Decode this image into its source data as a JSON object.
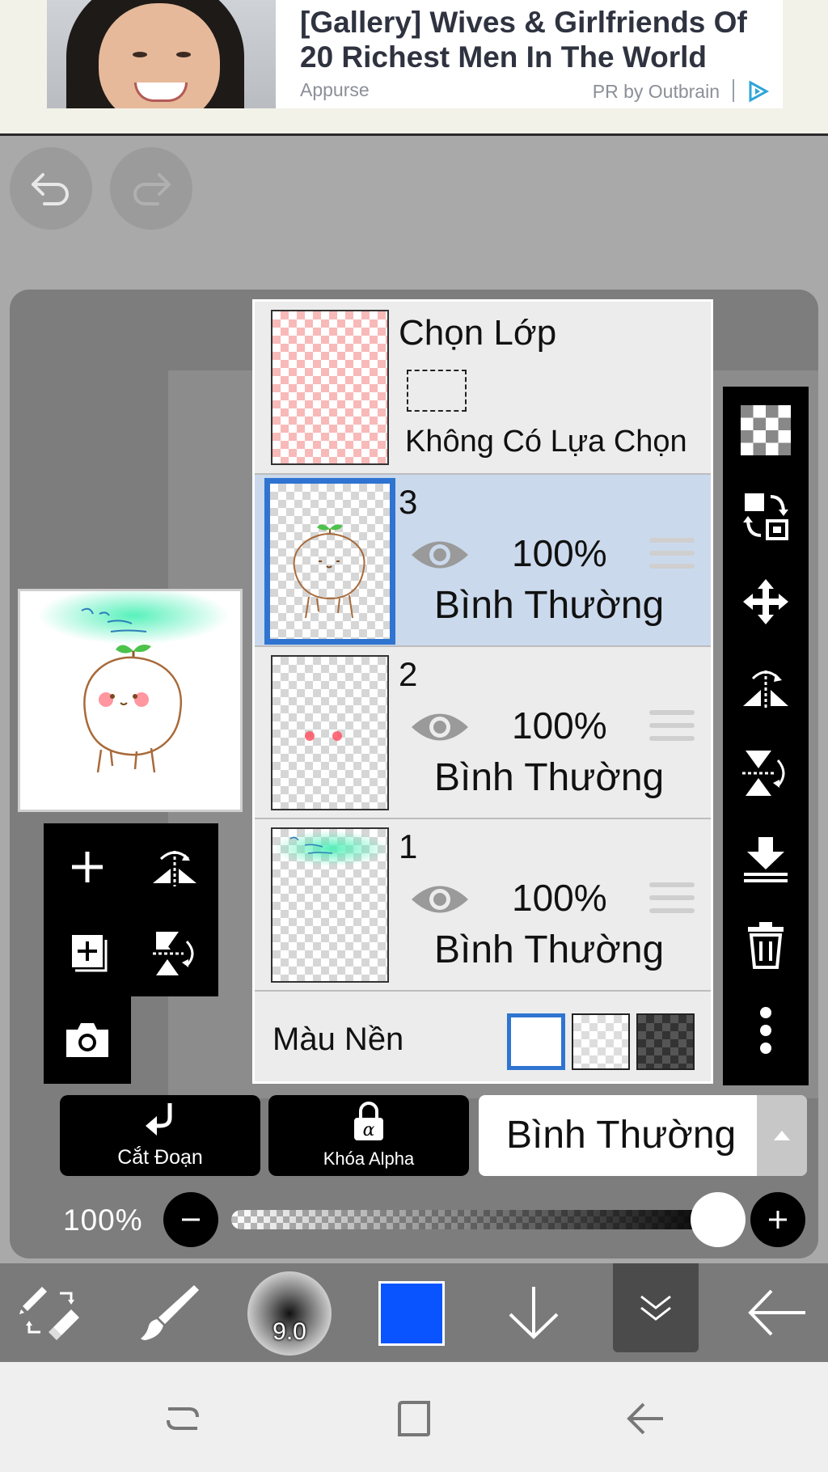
{
  "ad": {
    "title": "[Gallery] Wives & Girlfriends Of 20 Richest Men In The World",
    "source": "Appurse",
    "sponsor": "PR by Outbrain"
  },
  "layers_panel": {
    "selection": {
      "title": "Chọn Lớp",
      "status": "Không Có Lựa Chọn"
    },
    "layers": [
      {
        "number": "3",
        "opacity": "100%",
        "blend": "Bình Thường",
        "selected": true
      },
      {
        "number": "2",
        "opacity": "100%",
        "blend": "Bình Thường",
        "selected": false
      },
      {
        "number": "1",
        "opacity": "100%",
        "blend": "Bình Thường",
        "selected": false
      }
    ],
    "background": {
      "label": "Màu Nền",
      "options": [
        "white",
        "transparent",
        "dark-checker"
      ],
      "selected": "white"
    }
  },
  "actions": {
    "clip_label": "Cắt Đoạn",
    "alpha_lock_label": "Khóa Alpha",
    "blend_mode": "Bình Thường"
  },
  "opacity": {
    "label": "100%",
    "value": 1.0
  },
  "brush": {
    "size": "9.0",
    "color": "#0a54ff"
  },
  "colors": {
    "accent": "#2f74d0",
    "selected_row": "#cbd9ec"
  }
}
